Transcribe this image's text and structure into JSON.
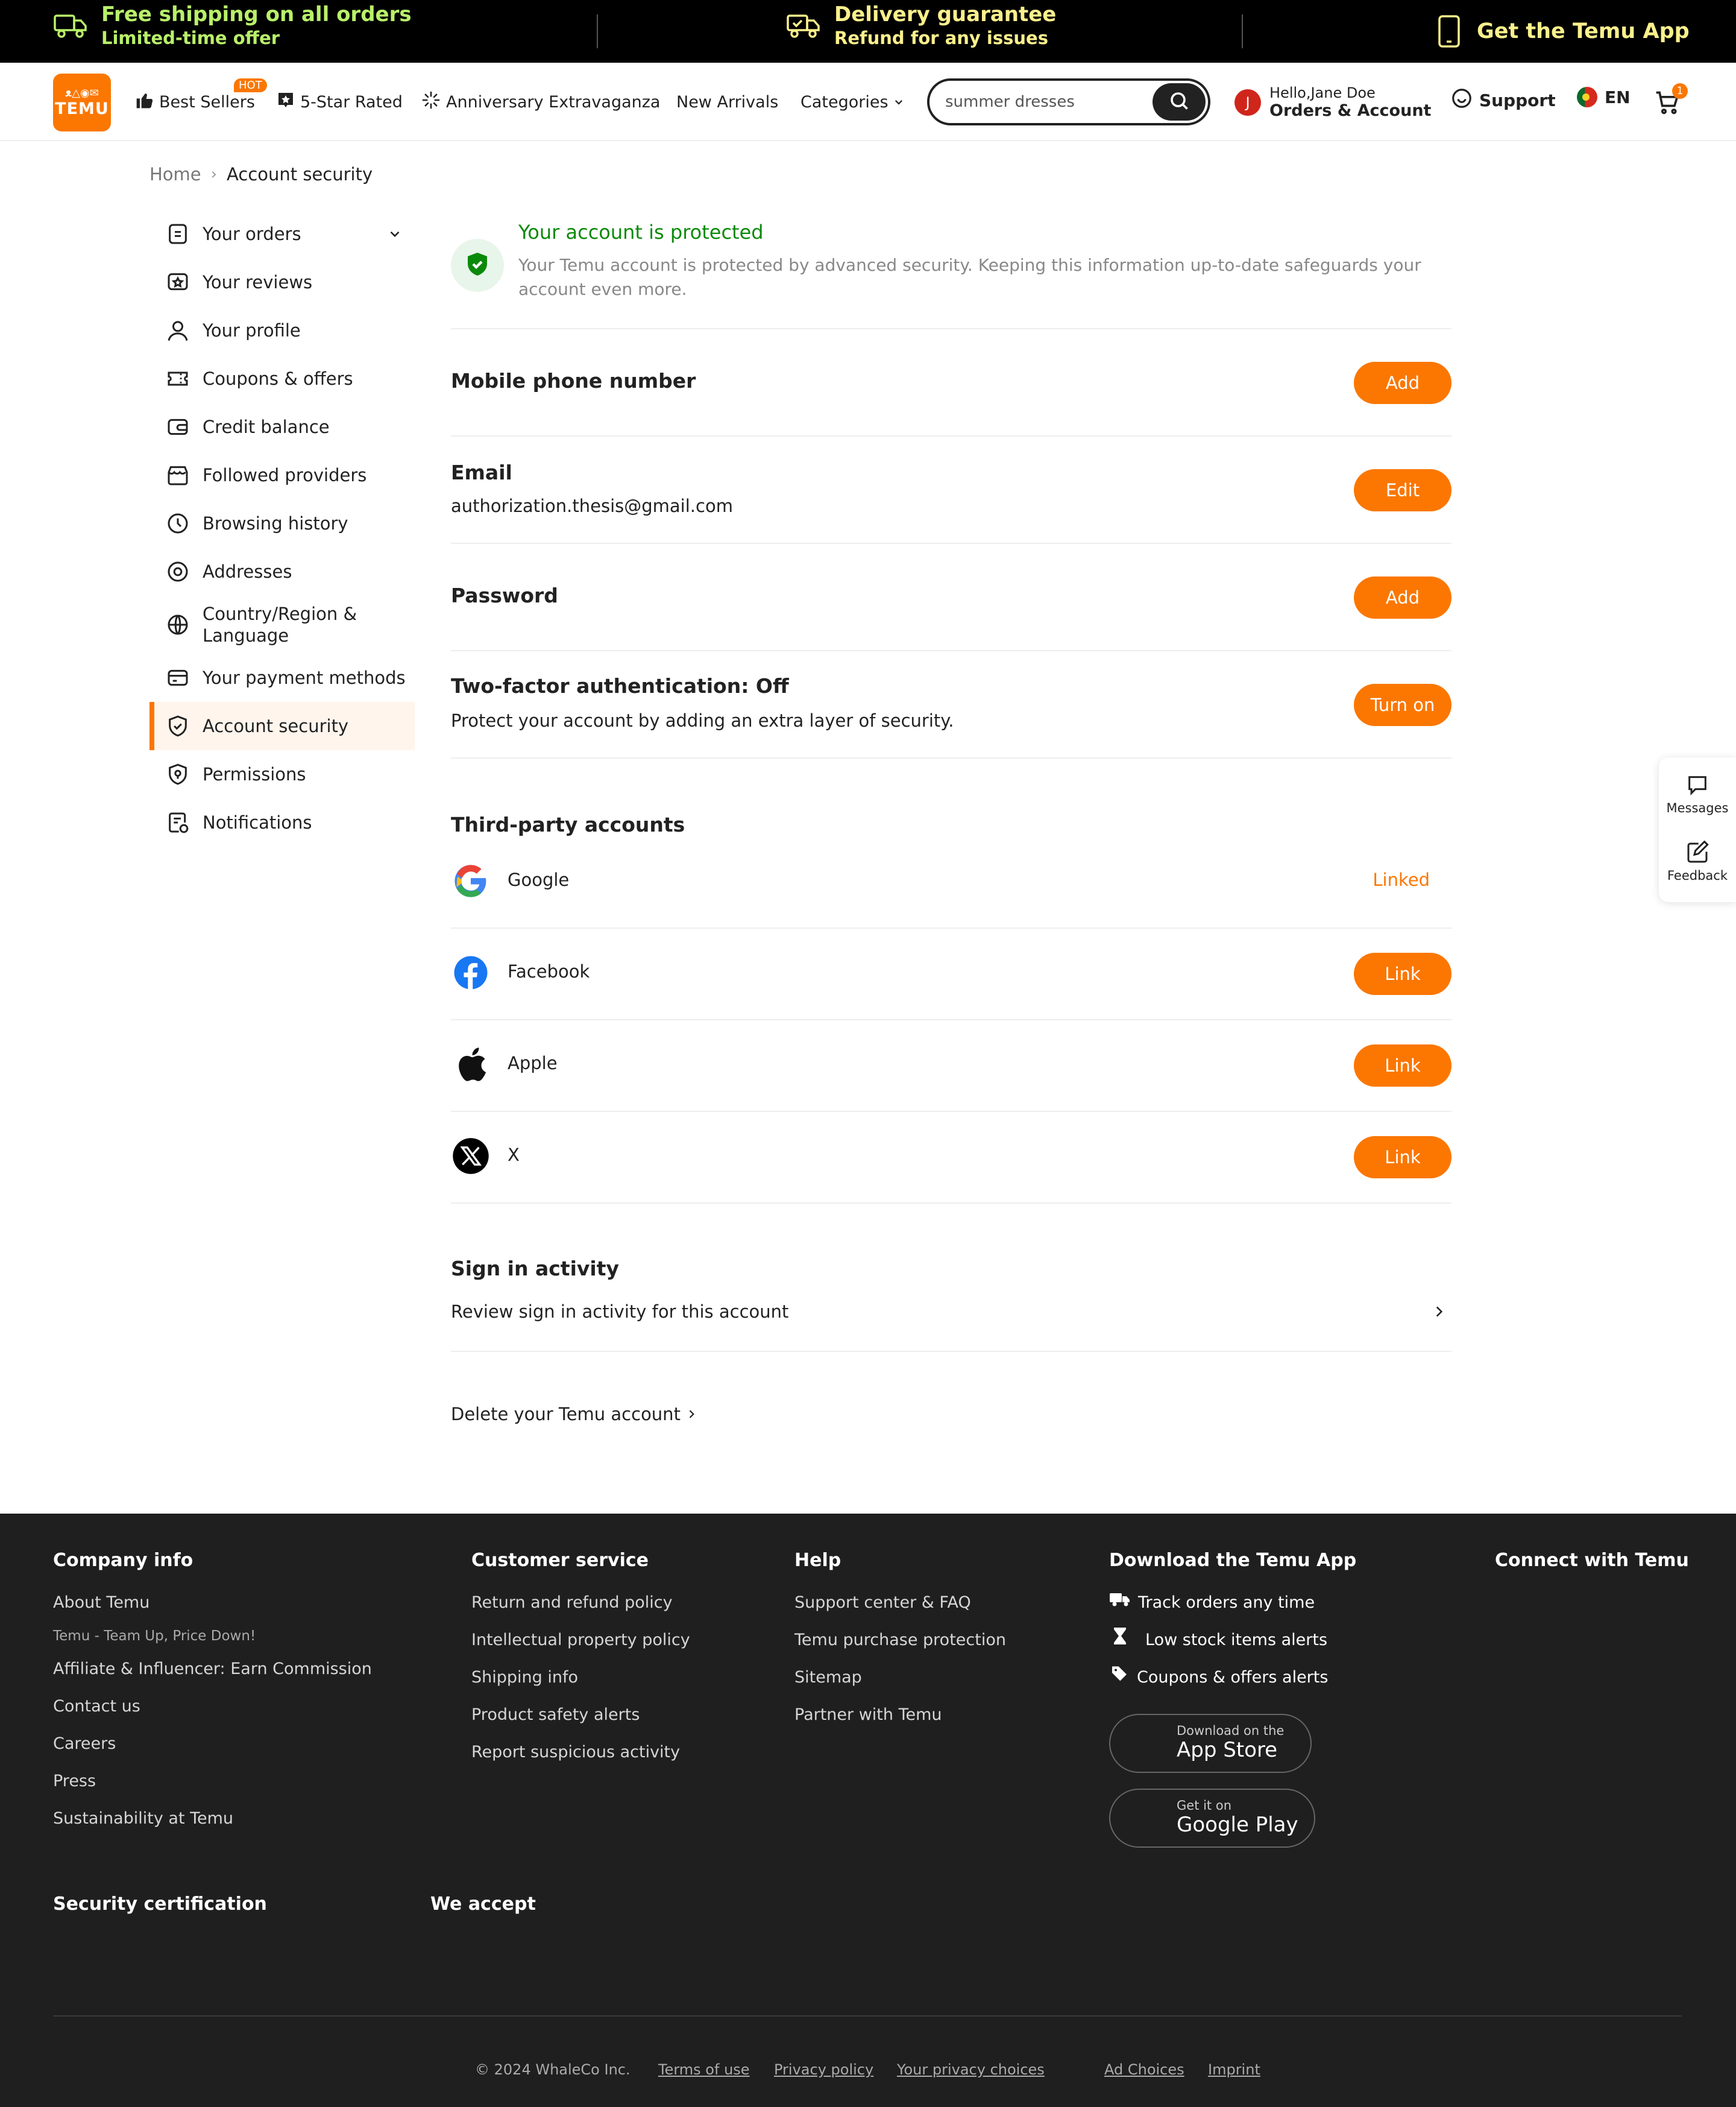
{
  "promo": {
    "shipping_title": "Free shipping on all orders",
    "shipping_sub": "Limited-time offer",
    "delivery_title": "Delivery guarantee",
    "delivery_sub": "Refund for any issues",
    "app_label": "Get the Temu App"
  },
  "header": {
    "logo_top": "ᴥ△◉✉",
    "logo_text": "TEMU",
    "nav": {
      "best_sellers": "Best Sellers",
      "hot_badge": "HOT",
      "five_star": "5-Star Rated",
      "anniversary": "Anniversary Extravaganza",
      "new_arrivals": "New Arrivals",
      "categories": "Categories"
    },
    "search_value": "summer dresses",
    "avatar_initial": "J",
    "hello": "Hello,Jane Doe",
    "orders_account": "Orders & Account",
    "support": "Support",
    "language": "EN",
    "cart_count": "1"
  },
  "breadcrumb": {
    "home": "Home",
    "separator": "›",
    "current": "Account security"
  },
  "sidebar": {
    "items": [
      {
        "label": "Your orders"
      },
      {
        "label": "Your reviews"
      },
      {
        "label": "Your profile"
      },
      {
        "label": "Coupons & offers"
      },
      {
        "label": "Credit balance"
      },
      {
        "label": "Followed providers"
      },
      {
        "label": "Browsing history"
      },
      {
        "label": "Addresses"
      },
      {
        "label": "Country/Region & Language"
      },
      {
        "label": "Your payment methods"
      },
      {
        "label": "Account security"
      },
      {
        "label": "Permissions"
      },
      {
        "label": "Notifications"
      }
    ]
  },
  "main": {
    "protected_title": "Your account is protected",
    "protected_desc": "Your Temu account is protected by advanced security. Keeping this information up-to-date safeguards your account even more.",
    "mobile_title": "Mobile phone number",
    "mobile_btn": "Add",
    "email_title": "Email",
    "email_value": "authorization.thesis@gmail.com",
    "email_btn": "Edit",
    "password_title": "Password",
    "password_btn": "Add",
    "twofa_title": "Two-factor authentication: Off",
    "twofa_desc": "Protect your account by adding an extra layer of security.",
    "twofa_btn": "Turn on",
    "third_party_title": "Third-party accounts",
    "third_party": [
      {
        "name": "Google",
        "status": "Linked"
      },
      {
        "name": "Facebook",
        "action": "Link"
      },
      {
        "name": "Apple",
        "action": "Link"
      },
      {
        "name": "X",
        "action": "Link"
      }
    ],
    "signin_title": "Sign in activity",
    "signin_desc": "Review sign in activity for this account",
    "delete_label": "Delete your Temu account"
  },
  "floating": {
    "messages": "Messages",
    "feedback": "Feedback"
  },
  "footer": {
    "company": {
      "title": "Company info",
      "links": [
        "About Temu",
        "Temu - Team Up, Price Down!",
        "Affiliate & Influencer: Earn Commission",
        "Contact us",
        "Careers",
        "Press",
        "Sustainability at Temu"
      ]
    },
    "customer": {
      "title": "Customer service",
      "links": [
        "Return and refund policy",
        "Intellectual property policy",
        "Shipping info",
        "Product safety alerts",
        "Report suspicious activity"
      ]
    },
    "help": {
      "title": "Help",
      "links": [
        "Support center & FAQ",
        "Temu purchase protection",
        "Sitemap",
        "Partner with Temu"
      ]
    },
    "download": {
      "title": "Download the Temu App",
      "features": [
        "Track orders any time",
        "Low stock items alerts",
        "Coupons & offers alerts"
      ],
      "appstore_small": "Download on the",
      "appstore_big": "App Store",
      "gplay_small": "Get it on",
      "gplay_big": "Google Play"
    },
    "connect_title": "Connect with Temu",
    "security_title": "Security certification",
    "accept_title": "We accept",
    "bottom": {
      "copyright": "© 2024 WhaleCo Inc.",
      "terms": "Terms of use",
      "privacy": "Privacy policy",
      "choices": "Your privacy choices",
      "adchoices": "Ad Choices",
      "imprint": "Imprint"
    }
  },
  "colors": {
    "accent": "#fb7701",
    "promo_green": "#b9f06a",
    "promo_yellow": "#fbf08c",
    "protected_green": "#0a8a0a",
    "footer_bg": "#1f1f1f"
  }
}
